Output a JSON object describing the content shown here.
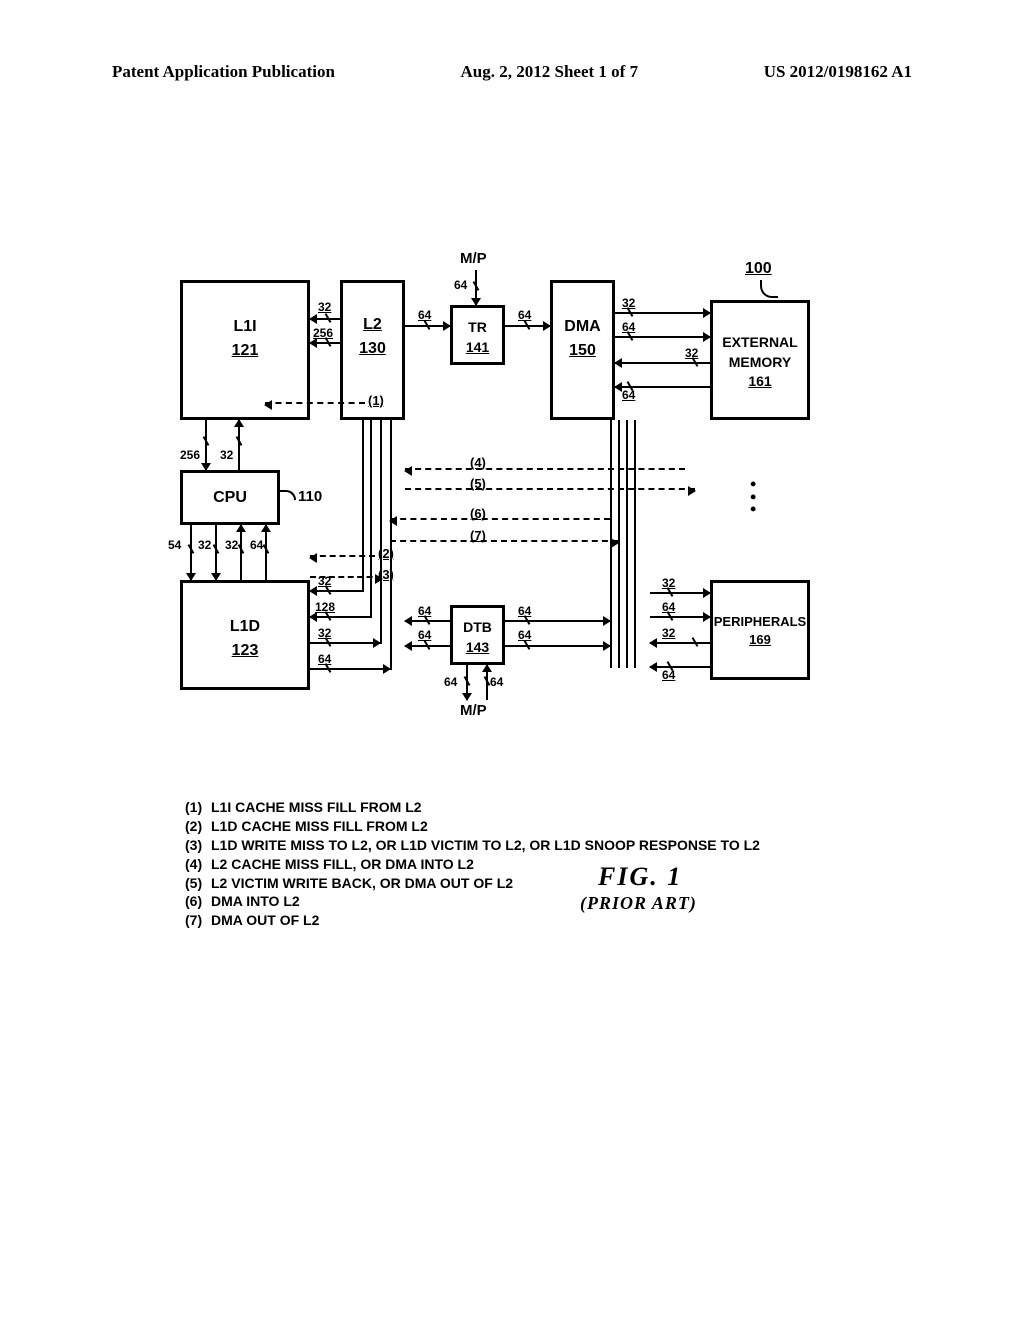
{
  "header": {
    "left": "Patent Application Publication",
    "center": "Aug. 2, 2012  Sheet 1 of 7",
    "right": "US 2012/0198162 A1"
  },
  "figure": {
    "label": "FIG.  1",
    "note": "(PRIOR ART)"
  },
  "ref": {
    "r100": "100",
    "r110": "110"
  },
  "mp": "M/P",
  "blocks": {
    "l1i": {
      "name": "L1I",
      "num": "121"
    },
    "l2": {
      "name": "L2",
      "num": "130"
    },
    "tr": {
      "name": "TR",
      "num": "141"
    },
    "dma": {
      "name": "DMA",
      "num": "150"
    },
    "ext": {
      "name": "EXTERNAL MEMORY",
      "num": "161"
    },
    "cpu": {
      "name": "CPU"
    },
    "l1d": {
      "name": "L1D",
      "num": "123"
    },
    "dtb": {
      "name": "DTB",
      "num": "143"
    },
    "per": {
      "name": "PERIPHERALS",
      "num": "169"
    }
  },
  "bus": {
    "w32": "32",
    "w64": "64",
    "w54": "54",
    "w128": "128",
    "w256": "256"
  },
  "paths": {
    "p1": "(1)",
    "p2": "(2)",
    "p3": "(3)",
    "p4": "(4)",
    "p5": "(5)",
    "p6": "(6)",
    "p7": "(7)"
  },
  "legend": [
    {
      "n": "(1)",
      "t": "L1I CACHE MISS FILL FROM L2"
    },
    {
      "n": "(2)",
      "t": "L1D CACHE MISS FILL FROM L2"
    },
    {
      "n": "(3)",
      "t": "L1D WRITE MISS TO L2, OR L1D VICTIM TO L2, OR L1D SNOOP RESPONSE TO L2"
    },
    {
      "n": "(4)",
      "t": "L2 CACHE MISS FILL, OR DMA INTO L2"
    },
    {
      "n": "(5)",
      "t": "L2 VICTIM WRITE BACK, OR DMA OUT OF L2"
    },
    {
      "n": "(6)",
      "t": "DMA INTO L2"
    },
    {
      "n": "(7)",
      "t": "DMA OUT OF L2"
    }
  ]
}
